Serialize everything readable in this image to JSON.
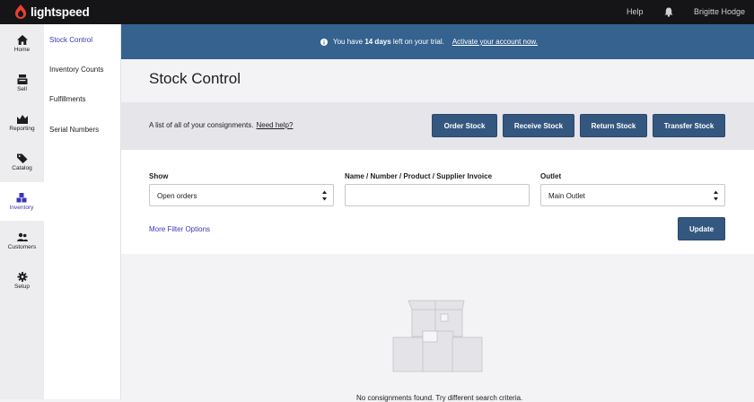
{
  "topbar": {
    "brand": "lightspeed",
    "help_label": "Help",
    "bell_icon": "bell-icon",
    "user_name": "Brigitte Hodge"
  },
  "rail": {
    "items": [
      {
        "label": "Home",
        "icon": "home-icon"
      },
      {
        "label": "Sell",
        "icon": "register-icon"
      },
      {
        "label": "Reporting",
        "icon": "chart-icon"
      },
      {
        "label": "Catalog",
        "icon": "tag-icon"
      },
      {
        "label": "Inventory",
        "icon": "boxes-icon",
        "active": true
      },
      {
        "label": "Customers",
        "icon": "people-icon"
      },
      {
        "label": "Setup",
        "icon": "gear-icon"
      }
    ]
  },
  "subnav": {
    "items": [
      {
        "label": "Stock Control",
        "active": true
      },
      {
        "label": "Inventory Counts"
      },
      {
        "label": "Fulfillments"
      },
      {
        "label": "Serial Numbers"
      }
    ]
  },
  "banner": {
    "prefix": "You have",
    "days": "14 days",
    "suffix": "left on your trial.",
    "link": "Activate your account now."
  },
  "page": {
    "title": "Stock Control",
    "description": "A list of all of your consignments.",
    "help_link": "Need help?"
  },
  "actions": {
    "order": "Order Stock",
    "receive": "Receive Stock",
    "return": "Return Stock",
    "transfer": "Transfer Stock"
  },
  "filters": {
    "show_label": "Show",
    "show_value": "Open orders",
    "search_label": "Name / Number / Product / Supplier Invoice",
    "search_value": "",
    "outlet_label": "Outlet",
    "outlet_value": "Main Outlet",
    "more_link": "More Filter Options",
    "update_label": "Update"
  },
  "empty": {
    "illustration": "empty-boxes-illustration",
    "message": "No consignments found. Try different search criteria."
  },
  "colors": {
    "topbar": "#151518",
    "banner": "#35628f",
    "button": "#34577f",
    "accent": "#3a37b4"
  }
}
